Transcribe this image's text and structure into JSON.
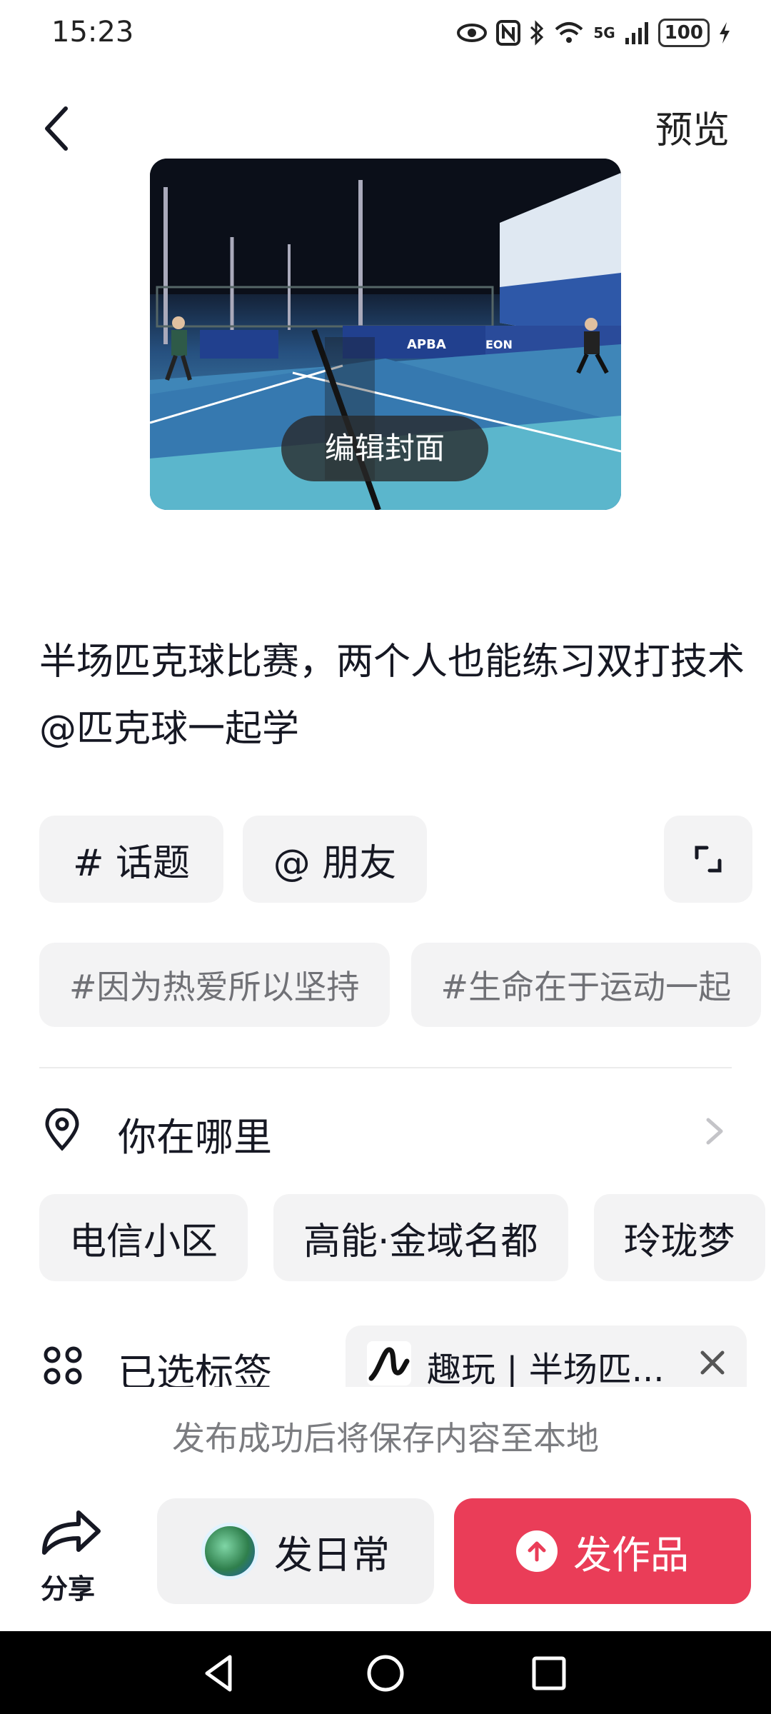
{
  "status_bar": {
    "time": "15:23",
    "icons": [
      "eye-icon",
      "nfc-icon",
      "bluetooth-icon",
      "wifi-icon",
      "signal-icon"
    ],
    "network": "5G",
    "battery": "100"
  },
  "header": {
    "back_icon": "chevron-left-icon",
    "preview_label": "预览"
  },
  "cover": {
    "edit_label": "编辑封面",
    "banners": [
      "APBA",
      "EON"
    ]
  },
  "caption": {
    "text": "半场匹克球比赛，两个人也能练习双打技术@匹克球一起学"
  },
  "actions": {
    "topic_label": "# 话题",
    "friend_label": "@ 朋友",
    "expand_icon": "expand-icon"
  },
  "hashtags": [
    "#因为热爱所以坚持",
    "#生命在于运动一起"
  ],
  "location": {
    "label": "你在哪里",
    "suggestions": [
      "电信小区",
      "高能·金域名都",
      "玲珑梦"
    ]
  },
  "tags": {
    "label": "已选标签",
    "selected": "趣玩 | 半场匹..."
  },
  "footer": {
    "save_note": "发布成功后将保存内容至本地",
    "share_label": "分享",
    "daily_label": "发日常",
    "publish_label": "发作品"
  },
  "colors": {
    "publish": "#ea3d58",
    "chip_bg": "#f3f3f4"
  }
}
